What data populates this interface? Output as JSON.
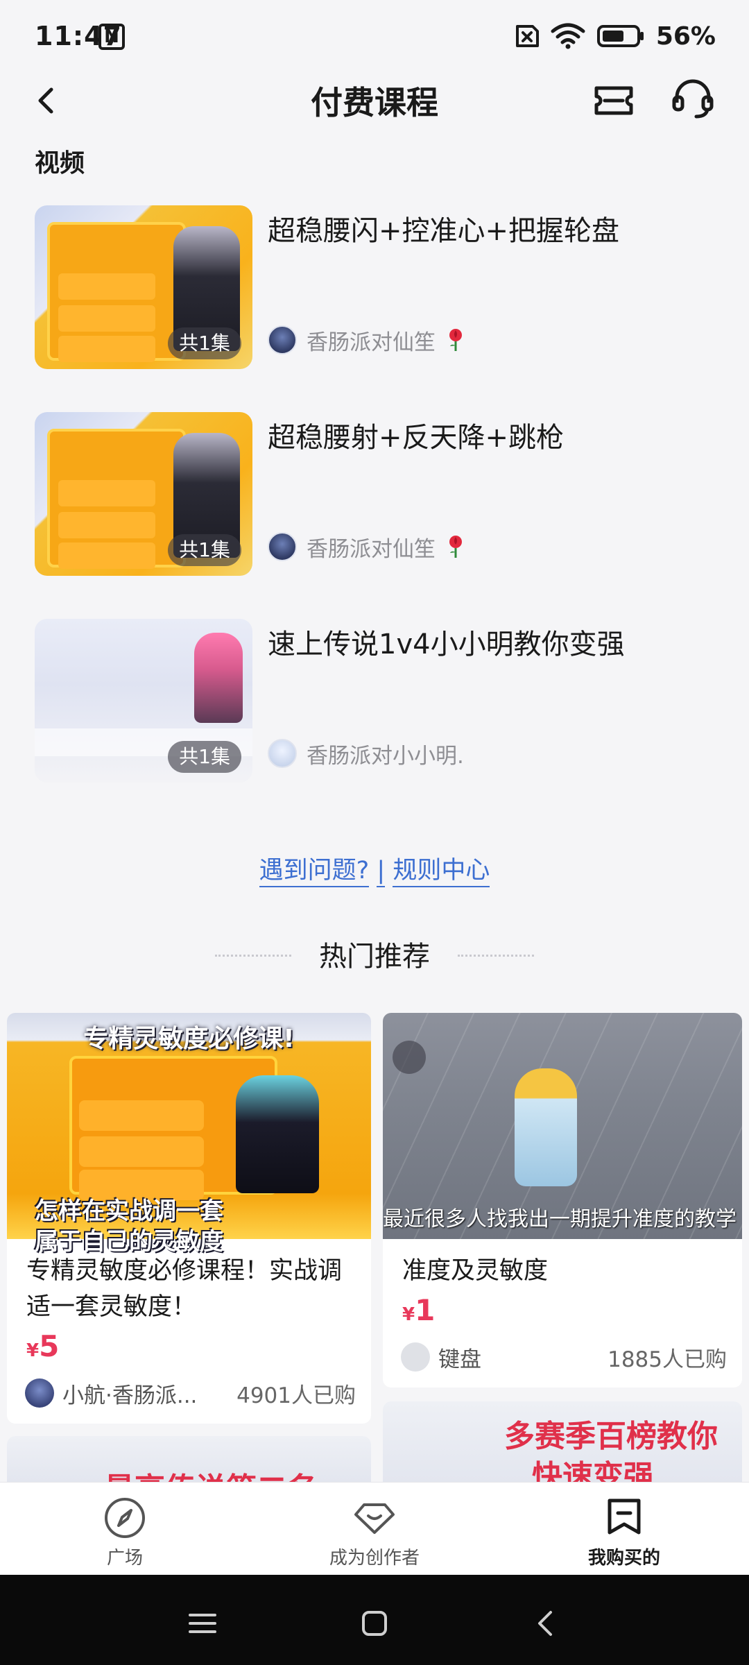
{
  "status_bar": {
    "time": "11:47",
    "nfc_glyph": "N",
    "battery": "56%"
  },
  "header": {
    "title": "付费课程"
  },
  "section": {
    "label": "视频"
  },
  "videos": [
    {
      "title": "超稳腰闪+控准心+把握轮盘",
      "episodes": "共1集",
      "author": "香肠派对仙笙"
    },
    {
      "title": "超稳腰射+反天降+跳枪",
      "episodes": "共1集",
      "author": "香肠派对仙笙"
    },
    {
      "title": "速上传说1v4小小明教你变强",
      "episodes": "共1集",
      "author": "香肠派对小小明."
    }
  ],
  "help": {
    "question": "遇到问题?",
    "separator": "|",
    "rules": "规则中心"
  },
  "hot": {
    "title": "热门推荐"
  },
  "recommend": [
    {
      "image_top_text": "专精灵敏度必修课!",
      "image_caption_1": "怎样在实战调一套",
      "image_caption_2": "属于自己的灵敏度",
      "title": "专精灵敏度必修课程！实战调适一套灵敏度！",
      "price_symbol": "¥",
      "price": "5",
      "author": "小航·香肠派...",
      "buyers": "4901人已购"
    },
    {
      "image_caption": "最近很多人找我出一期提升准度的教学",
      "title": "准度及灵敏度",
      "price_symbol": "¥",
      "price": "1",
      "author": "键盘",
      "buyers": "1885人已购"
    },
    {
      "image_text": "最高传说第二名"
    },
    {
      "image_text_1": "多赛季百榜教你",
      "image_text_2": "快速变强"
    }
  ],
  "tabs": [
    {
      "label": "广场",
      "icon": "compass-icon"
    },
    {
      "label": "成为创作者",
      "icon": "creator-icon"
    },
    {
      "label": "我购买的",
      "icon": "purchased-icon"
    }
  ],
  "colors": {
    "link": "#3d6fd1",
    "price": "#e8385a",
    "background": "#f5f5f7"
  }
}
